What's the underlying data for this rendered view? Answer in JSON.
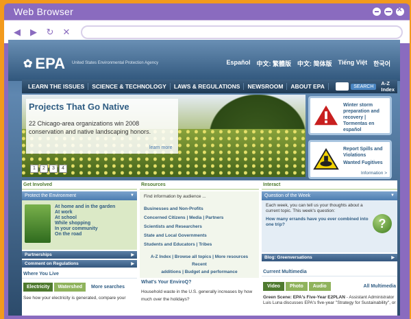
{
  "browser": {
    "title": "Web Browser",
    "nav": {
      "back": "◀",
      "forward": "▶",
      "reload": "↻",
      "stop": "✕"
    },
    "url": ""
  },
  "site": {
    "logo": "EPA",
    "agency": "United States Environmental Protection Agency",
    "languages": [
      "Español",
      "中文: 繁體版",
      "中文: 简体版",
      "Tiếng Việt",
      "한국어"
    ],
    "menu": [
      "LEARN THE ISSUES",
      "SCIENCE & TECHNOLOGY",
      "LAWS & REGULATIONS",
      "NEWSROOM",
      "ABOUT EPA"
    ],
    "search_label": "SEARCH",
    "az_label": "A-Z Index"
  },
  "hero": {
    "title": "Projects That Go Native",
    "text": "22 Chicago-area organizations win 2008 conservation and native landscaping honors.",
    "learn_more": "learn more",
    "pages": [
      "1",
      "2",
      "3",
      "4"
    ]
  },
  "alerts": {
    "a1": {
      "lines": [
        "Winter storm preparation and recovery |",
        "Tormentas en español"
      ]
    },
    "a2": {
      "lines": [
        "Report Spills and Violations",
        "Wanted Fugitives"
      ],
      "info": "Information >"
    }
  },
  "get_involved": {
    "heading": "Get Involved",
    "panel_title": "Protect the Environment",
    "links": [
      "At home and in the garden",
      "At work",
      "At school",
      "While shopping",
      "In your community",
      "On the road"
    ],
    "bar1": "Partnerships",
    "bar2": "Comment on Regulations"
  },
  "resources": {
    "heading": "Resources",
    "prompt": "Find information by audience ...",
    "links": [
      "Businesses and Non-Profits",
      "Concerned Citizens | Media | Partners",
      "Scientists and Researchers",
      "State and Local Governments",
      "Students and Educators | Tribes"
    ],
    "footer1": "A-Z Index | Browse all topics | More resources Recent",
    "footer2": "additions | Budget and performance"
  },
  "interact": {
    "heading": "Interact",
    "panel_title": "Question of the Week",
    "text": "Each week, you can tell us your thoughts about a current topic. This week's question:",
    "question": "How many errands have you ever combined into one trip?",
    "qmark": "?",
    "blog": "Blog: Greenversations"
  },
  "where_you_live": {
    "heading": "Where You Live",
    "tabs": [
      "Electricity",
      "Watershed"
    ],
    "more": "More searches",
    "text": "See how your electricity is generated, compare your"
  },
  "enviroq": {
    "heading": "What's Your EnviroQ?",
    "text": "Household waste in the U.S. generally increases by how much over the holidays?"
  },
  "multimedia": {
    "heading": "Current Multimedia",
    "tabs": [
      "Video",
      "Photo",
      "Audio"
    ],
    "all": "All Multimedia",
    "caption_title": "Green Scene: EPA's Five-Year E2PLAN",
    "caption": "- Assistant Administrator Luis Luna discusses EPA's five-year \"Strategy for Sustainability\", or"
  }
}
